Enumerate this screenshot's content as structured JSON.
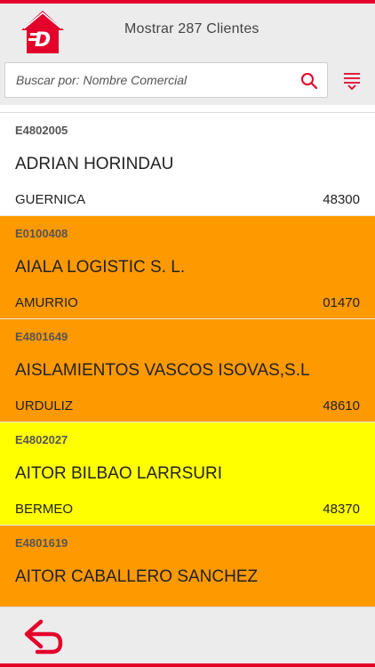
{
  "header": {
    "title": "Mostrar 287 Clientes",
    "logo_icon": "house-logo-icon"
  },
  "search": {
    "placeholder": "Buscar por: Nombre Comercial",
    "value": ""
  },
  "colors": {
    "accent": "#e3002b",
    "row_white": "#ffffff",
    "row_orange": "#ff9900",
    "row_yellow": "#ffff00"
  },
  "clients": [
    {
      "code": "E4802005",
      "name": "ADRIAN HORINDAU",
      "city": "GUERNICA",
      "zip": "48300",
      "color": "#ffffff"
    },
    {
      "code": "E0100408",
      "name": "AIALA LOGISTIC S. L.",
      "city": "AMURRIO",
      "zip": "01470",
      "color": "#ff9900"
    },
    {
      "code": "E4801649",
      "name": "AISLAMIENTOS VASCOS ISOVAS,S.L",
      "city": "URDULIZ",
      "zip": "48610",
      "color": "#ff9900"
    },
    {
      "code": "E4802027",
      "name": "AITOR BILBAO LARRSURI",
      "city": "BERMEO",
      "zip": "48370",
      "color": "#ffff00"
    },
    {
      "code": "E4801619",
      "name": "AITOR CABALLERO SANCHEZ",
      "city": "",
      "zip": "",
      "color": "#ff9900"
    }
  ],
  "footer": {
    "back_icon": "back-arrow-icon"
  }
}
